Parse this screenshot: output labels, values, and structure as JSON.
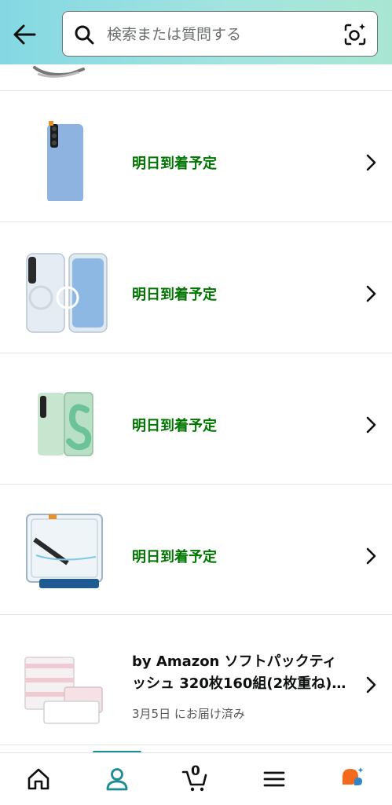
{
  "header": {
    "search_placeholder": "検索または質問する"
  },
  "orders": [
    {
      "status": "明日到着予定"
    },
    {
      "status": "明日到着予定"
    },
    {
      "status": "明日到着予定"
    },
    {
      "status": "明日到着予定"
    }
  ],
  "product": {
    "title_line1": "by Amazon ソフトパックティ",
    "title_line2": "ッシュ 320枚160組(2枚重ね)…",
    "delivered": "3月5日 にお届け済み"
  },
  "bottom_nav": {
    "cart_count": "0",
    "active": "account"
  },
  "colors": {
    "accent": "#1a8c92",
    "status_green": "#007600"
  }
}
